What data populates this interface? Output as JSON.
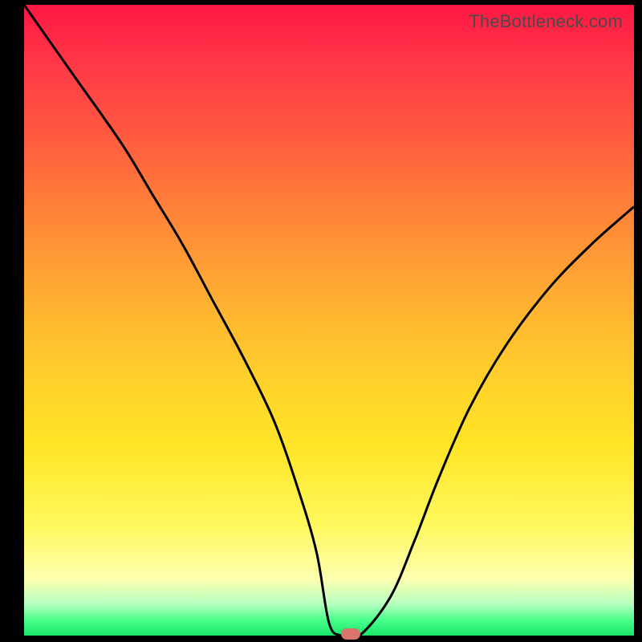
{
  "watermark": "TheBottleneck.com",
  "colors": {
    "curve_stroke": "#000000",
    "marker_fill": "#d8766e",
    "outer_bg": "#000000"
  },
  "chart_data": {
    "type": "line",
    "title": "",
    "xlabel": "",
    "ylabel": "",
    "xlim": [
      0,
      100
    ],
    "ylim": [
      0,
      100
    ],
    "series": [
      {
        "name": "bottleneck-curve",
        "x": [
          0,
          8,
          16,
          21,
          26,
          31,
          36,
          41,
          45,
          48,
          50,
          52,
          55,
          60,
          64,
          68,
          73,
          79,
          86,
          93,
          100
        ],
        "values": [
          100,
          89,
          78,
          70,
          62,
          53,
          44,
          34,
          23,
          13,
          2,
          0,
          0,
          6,
          15,
          25,
          36,
          46,
          55,
          62,
          68
        ]
      }
    ],
    "marker": {
      "x": 53.5,
      "y": 0
    }
  }
}
